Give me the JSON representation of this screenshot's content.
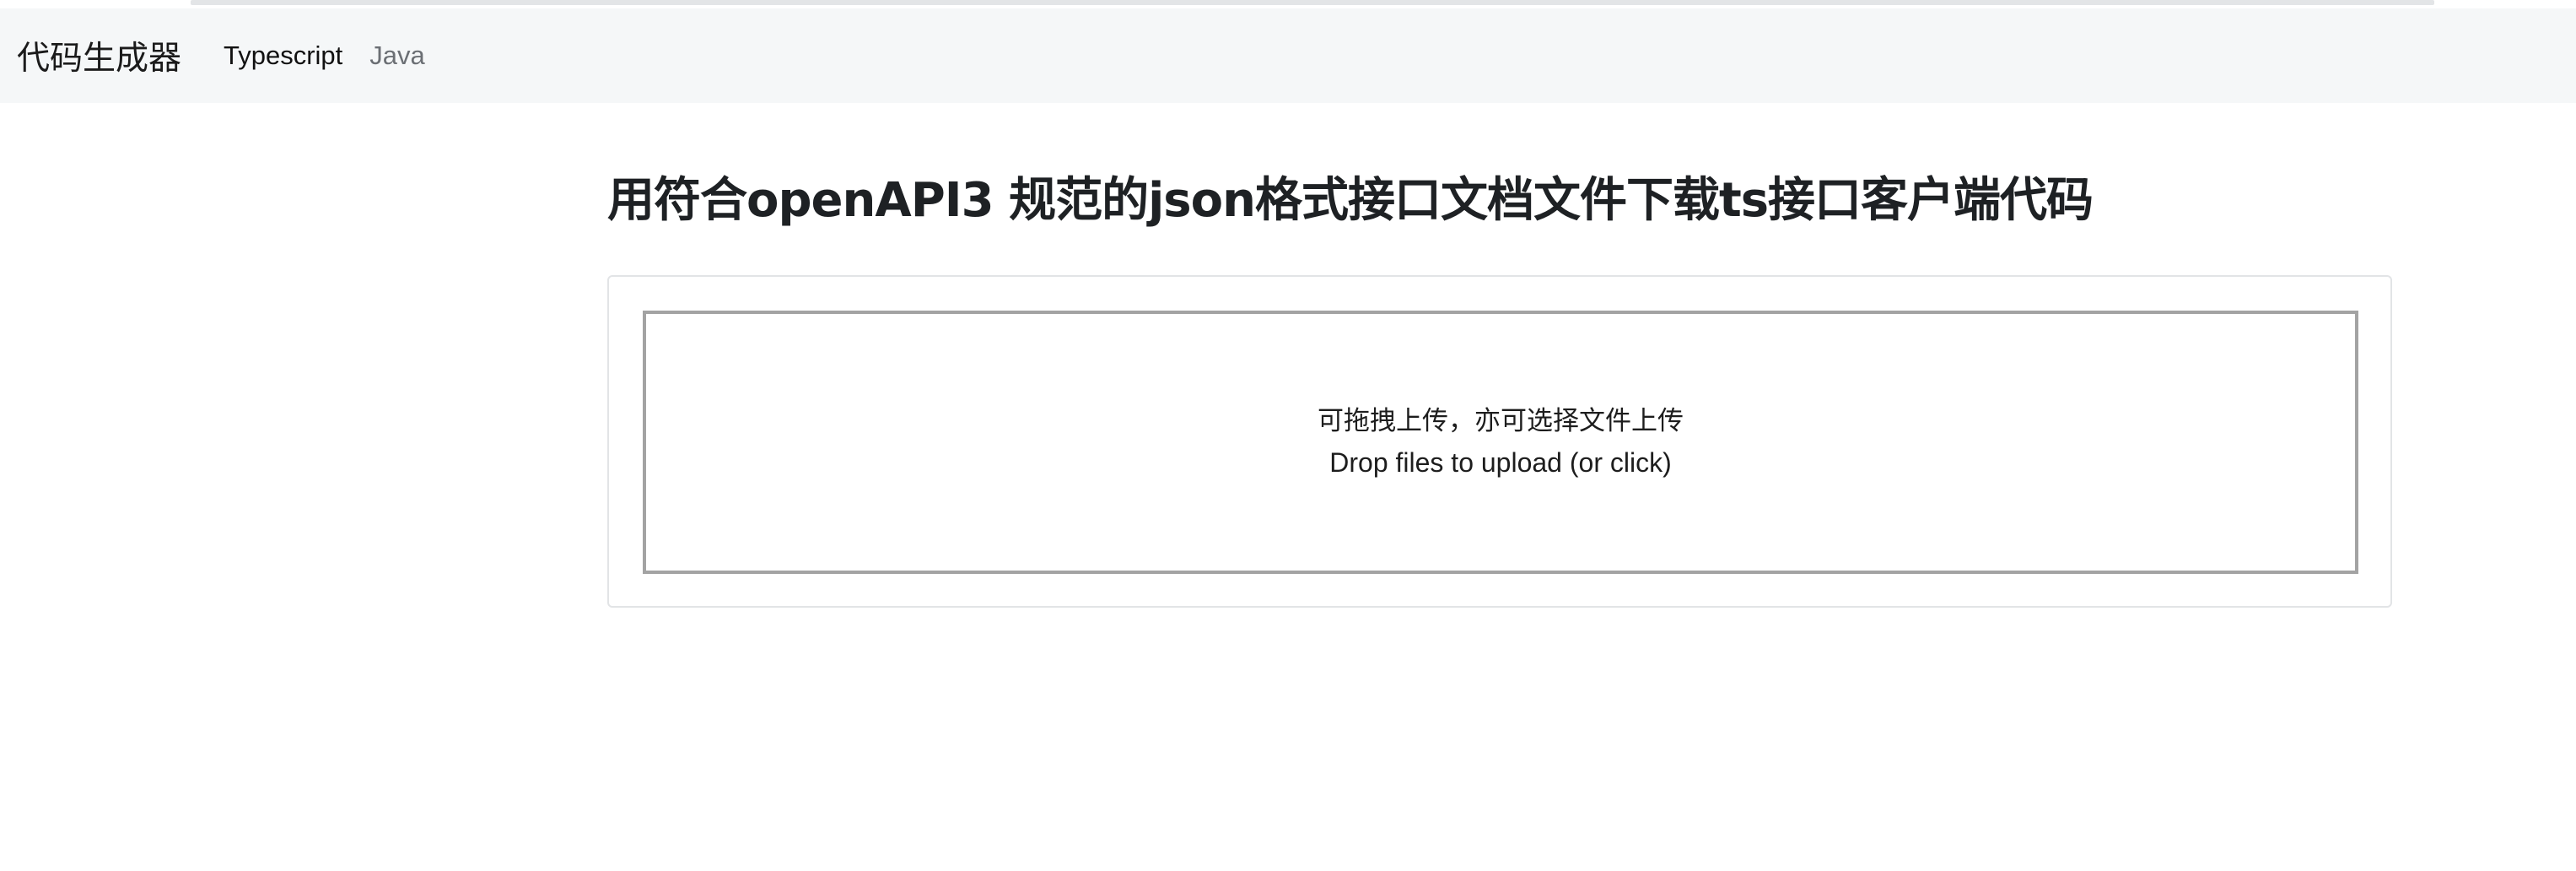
{
  "navbar": {
    "brand": "代码生成器",
    "links": [
      {
        "label": "Typescript",
        "active": true
      },
      {
        "label": "Java",
        "active": false
      }
    ]
  },
  "main": {
    "title": "用符合openAPI3 规范的json格式接口文档文件下载ts接口客户端代码",
    "dropzone": {
      "line_cn": "可拖拽上传，亦可选择文件上传",
      "line_en": "Drop files to upload (or click)"
    }
  },
  "colors": {
    "navbar_bg": "#f5f7f8",
    "dropzone_border": "#a3a3a3",
    "card_border": "#e2e4e6",
    "inactive_link": "#6b6f74"
  }
}
